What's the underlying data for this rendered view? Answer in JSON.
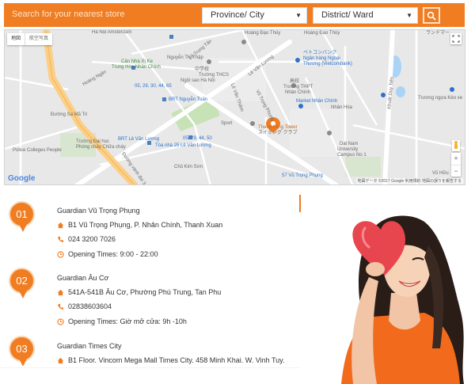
{
  "search": {
    "placeholder": "Search for your nearest store",
    "province_label": "Province/ City",
    "district_label": "District/ Ward"
  },
  "map": {
    "maptype_map": "地図",
    "maptype_satellite": "航空写真",
    "labels": [
      "Hà Nội Amsterdam",
      "Hoàng Đạo Thúy",
      "Hoàng Đạo Thúy",
      "ランドマー",
      "Căn Nhà Xì Ke",
      "Trung Hòa Nhân Chính",
      "Nguyễn Thị Thập",
      "中学校",
      "Trường THCS",
      "Ngôi sao Hà Nội",
      "ベトコンバンク",
      "Ngân hàng Ngoại",
      "Thương (Vietcombank)",
      "高校",
      "Trường THPT",
      "Nhân Chính",
      "Market Nhân Chính",
      "Lê Văn Lương",
      "Hoàng Ngân",
      "05, 29, 30, 44, 65",
      "BRT Nguyễn Tuân",
      "Lê Văn Thiêm",
      "Đường Sa Mã Tri",
      "Trường Đại học",
      "Phòng cháy Chữa cháy",
      "Police Colleges People",
      "Sport",
      "Thang Long Tower",
      "スイミング クラブ",
      "Dai Nam",
      "University",
      "Campus No 1",
      "Khuất Duy Tiến",
      "Vũ Trọng Phụng",
      "Nhân Hòa",
      "Trương ngựa Kéo xe",
      "BRT Lê Văn Lương",
      "Tòa nhà 25 Lê Văn Lương",
      "05, 29, 44, 50",
      "Chủ Kim Sơn",
      "57 Vũ Trọng Phụng",
      "Đường vành đai 3",
      "Lê Trọng Tấn",
      "Vũ Hữu"
    ],
    "google": "Google",
    "attribution": "地図データ ©2017 Google  利用規約  地図の誤りを報告する"
  },
  "stores": [
    {
      "number": "01",
      "name": "Guardian Vũ Trọng Phụng",
      "address": "B1 Vũ Trọng Phụng, P. Nhân Chính, Thanh Xuan",
      "phone": "024 3200 7026",
      "hours": "Opening Times: 9:00 - 22:00"
    },
    {
      "number": "02",
      "name": "Guardian Âu Cơ",
      "address": "541A-541B Âu Cơ, Phường Phú Trung, Tan Phu",
      "phone": "02838603604",
      "hours": "Opening Times: Giờ mở cửa: 9h -10h"
    },
    {
      "number": "03",
      "name": "Guardian Times City",
      "address": "B1 Floor. Vincom Mega Mall Times City. 458 Minh Khai. W. Vinh Tuy.",
      "phone": "",
      "hours": ""
    }
  ],
  "colors": {
    "accent": "#f07d22",
    "map_road": "#ffffff",
    "map_land": "#e8e8e8",
    "map_park": "#c8e2b7",
    "map_highway": "#fbcf86",
    "map_water": "#aad3f6"
  },
  "icons": {
    "address": "address-pin-icon",
    "phone": "phone-icon",
    "hours": "clock-icon",
    "search": "search-icon"
  }
}
